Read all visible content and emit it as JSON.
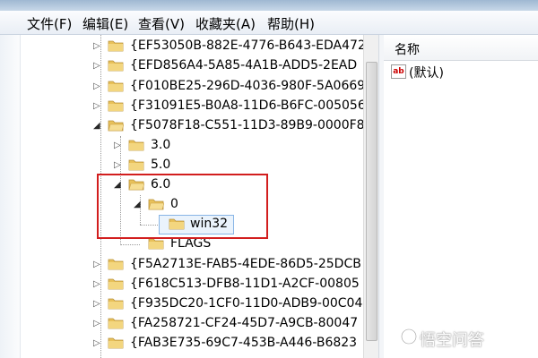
{
  "menu": [
    {
      "label": "文件(F)"
    },
    {
      "label": "编辑(E)"
    },
    {
      "label": "查看(V)"
    },
    {
      "label": "收藏夹(A)"
    },
    {
      "label": "帮助(H)"
    }
  ],
  "tree": {
    "items": [
      {
        "label": "{EF53050B-882E-4776-B643-EDA472"
      },
      {
        "label": "{EFD856A4-5A85-4A1B-ADD5-2EAD"
      },
      {
        "label": "{F010BE25-296D-4036-980F-5A0669"
      },
      {
        "label": "{F31091E5-B0A8-11D6-B6FC-005056"
      },
      {
        "label": "{F5078F18-C551-11D3-89B9-0000F8"
      },
      {
        "label": "3.0"
      },
      {
        "label": "5.0"
      },
      {
        "label": "6.0"
      },
      {
        "label": "0"
      },
      {
        "label": "win32"
      },
      {
        "label": "FLAGS"
      },
      {
        "label": "{F5A2713E-FAB5-4EDE-86D5-25DCB"
      },
      {
        "label": "{F618C513-DFB8-11D1-A2CF-00805"
      },
      {
        "label": "{F935DC20-1CF0-11D0-ADB9-00C04"
      },
      {
        "label": "{FA258721-CF24-45D7-A9CB-80047"
      },
      {
        "label": "{FAB3E735-69C7-453B-A446-B6823"
      }
    ]
  },
  "values_pane": {
    "column_header": "名称",
    "rows": [
      {
        "name": "(默认)"
      }
    ]
  },
  "watermark": {
    "text": "悟空问答"
  },
  "colors": {
    "highlight_border": "#d21e1e",
    "selected_bg": "#eaf3fc",
    "folder": "#e8c15a"
  }
}
